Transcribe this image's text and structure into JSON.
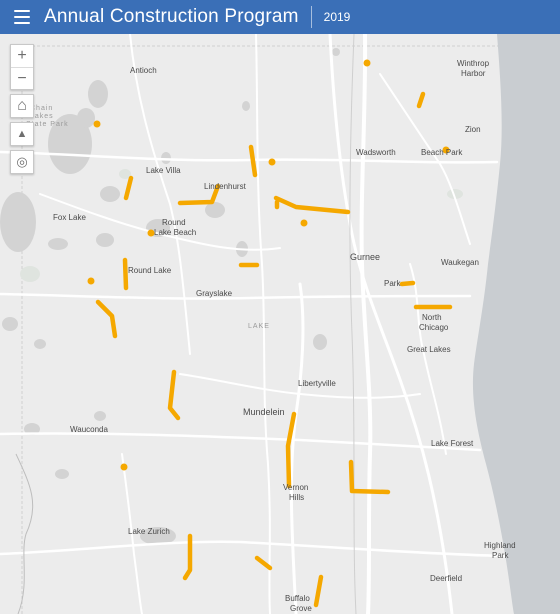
{
  "header": {
    "title": "Annual Construction Program",
    "year": "2019"
  },
  "map_controls": {
    "zoom_in": "+",
    "zoom_out": "−",
    "home": "⌂",
    "compass": "▲",
    "locate": "◎"
  },
  "places": {
    "antioch": "Antioch",
    "winthrop_harbor": "Winthrop\nHarbor",
    "zion": "Zion",
    "wadsworth": "Wadsworth",
    "beach_park": "Beach Park",
    "lake_villa": "Lake Villa",
    "lindenhurst": "Lindenhurst",
    "fox_lake": "Fox Lake",
    "round_lake_beach": "Round\nLake Beach",
    "gurnee": "Gurnee",
    "waukegan": "Waukegan",
    "round_lake": "Round Lake",
    "park_city": "Park",
    "grayslake": "Grayslake",
    "lake_county": "LAKE",
    "north_chicago": "North\nChicago",
    "great_lakes": "Great Lakes",
    "libertyville": "Libertyville",
    "mundelein": "Mundelein",
    "wauconda": "Wauconda",
    "lake_forest": "Lake Forest",
    "vernon_hills": "Vernon\nHills",
    "lake_zurich": "Lake Zurich",
    "highland_park": "Highland\nPark",
    "deerfield": "Deerfield",
    "buffalo_grove": "Buffalo\nGrove",
    "chain_lakes": "Chain\nLakes\nState Park"
  },
  "colors": {
    "header": "#3a6fb7",
    "project": "#f5a800",
    "water": "#d3d3d3",
    "lake_michigan": "#c9cdd1"
  }
}
